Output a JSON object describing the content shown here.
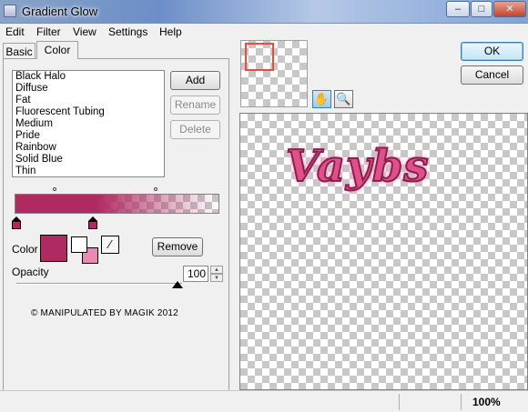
{
  "window": {
    "title": "Gradient Glow",
    "minimize": "–",
    "maximize": "□",
    "close": "✕"
  },
  "menu": [
    "Edit",
    "Filter",
    "View",
    "Settings",
    "Help"
  ],
  "tabs": [
    {
      "label": "Basic",
      "active": false
    },
    {
      "label": "Color",
      "active": true
    }
  ],
  "presets": [
    "Black Halo",
    "Diffuse",
    "Fat",
    "Fluorescent Tubing",
    "Medium",
    "Pride",
    "Rainbow",
    "Solid Blue",
    "Thin"
  ],
  "preset_buttons": {
    "add": "Add",
    "rename": "Rename",
    "delete": "Delete"
  },
  "color": {
    "label": "Color",
    "remove": "Remove",
    "main": "#b02a62",
    "swap_fg": "#ffffff",
    "swap_bg": "#e98ab5"
  },
  "opacity": {
    "label": "Opacity",
    "value": "100",
    "fraction": 1.0
  },
  "credit": "© MANIPULATED BY MAGIK 2012",
  "dialog": {
    "ok": "OK",
    "cancel": "Cancel"
  },
  "tools": [
    {
      "icon": "hand-icon",
      "glyph": "✋"
    },
    {
      "icon": "zoom-icon",
      "glyph": "🔍"
    }
  ],
  "preview_text": "Vaybs",
  "status": {
    "zoom": "100%"
  }
}
